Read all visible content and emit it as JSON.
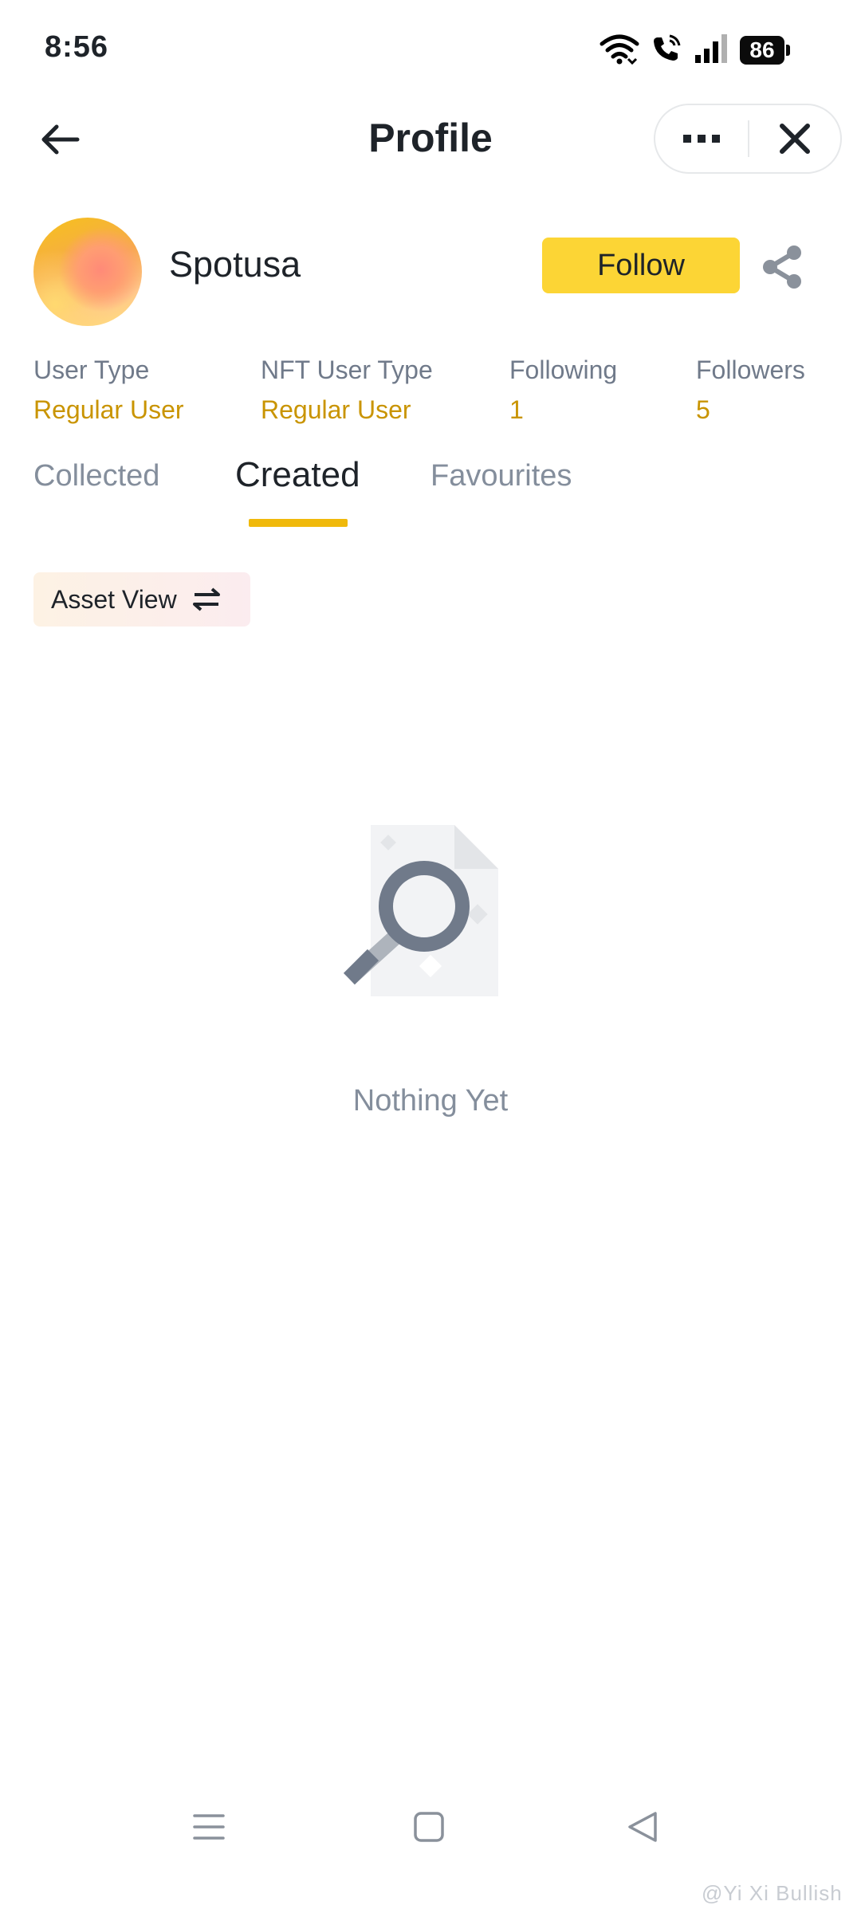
{
  "status_bar": {
    "time": "8:56",
    "battery": "86",
    "icons": [
      "wifi-icon",
      "wifi-call-icon",
      "signal-icon",
      "battery-icon"
    ]
  },
  "header": {
    "title": "Profile",
    "back_icon": "arrow-left-icon",
    "more_icon": "more-icon",
    "close_icon": "close-icon"
  },
  "profile": {
    "username": "Spotusa",
    "follow_label": "Follow",
    "share_icon": "share-icon"
  },
  "stats": [
    {
      "label": "User Type",
      "value": "Regular User"
    },
    {
      "label": "NFT User Type",
      "value": "Regular User"
    },
    {
      "label": "Following",
      "value": "1"
    },
    {
      "label": "Followers",
      "value": "5"
    }
  ],
  "tabs": [
    {
      "label": "Collected",
      "active": false
    },
    {
      "label": "Created",
      "active": true
    },
    {
      "label": "Favourites",
      "active": false
    }
  ],
  "asset_view": {
    "label": "Asset View",
    "icon": "swap-icon"
  },
  "empty_state": {
    "text": "Nothing Yet",
    "icon": "search-document-icon"
  },
  "nav_bar": {
    "icons": [
      "menu-icon",
      "home-icon",
      "back-triangle-icon"
    ]
  },
  "watermark": "@Yi Xi Bullish",
  "colors": {
    "accent_yellow": "#fcd535",
    "indicator": "#f0b90b",
    "value_gold": "#c99400",
    "muted_text": "#848e9c",
    "primary_text": "#1e2329"
  }
}
